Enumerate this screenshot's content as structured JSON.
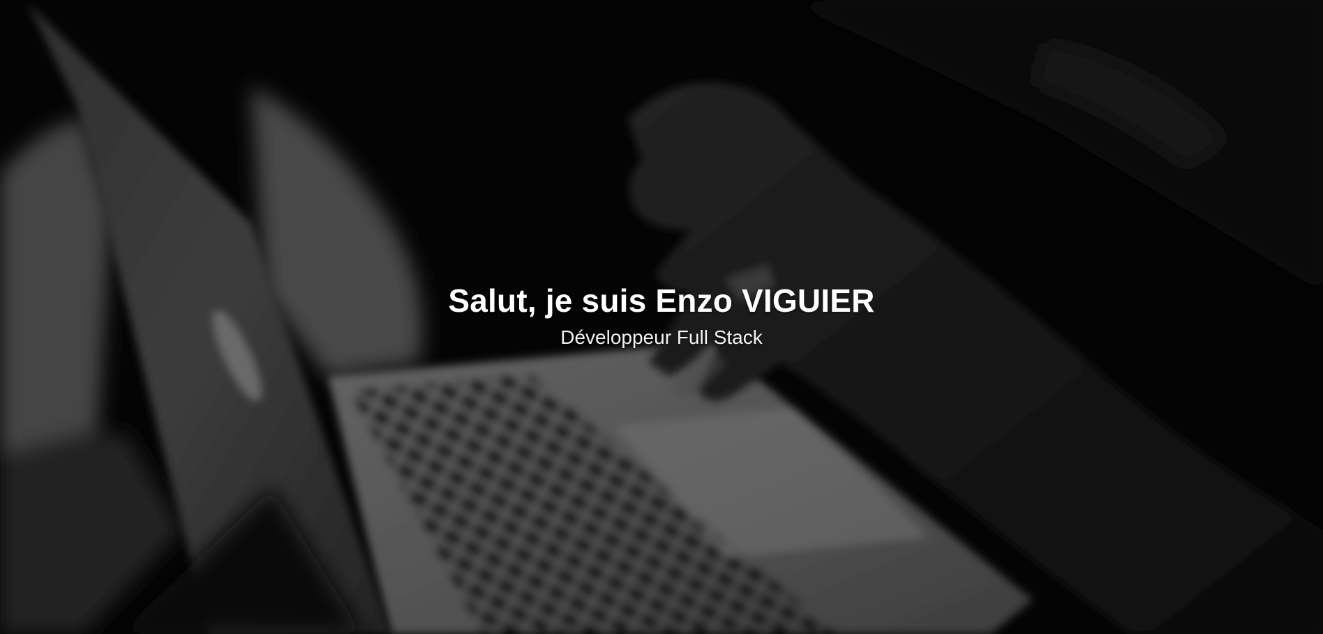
{
  "hero": {
    "title": "Salut, je suis Enzo VIGUIER",
    "subtitle": "Développeur Full Stack",
    "background_image": "laptop-typing-photo",
    "overlay_color": "#000000"
  }
}
